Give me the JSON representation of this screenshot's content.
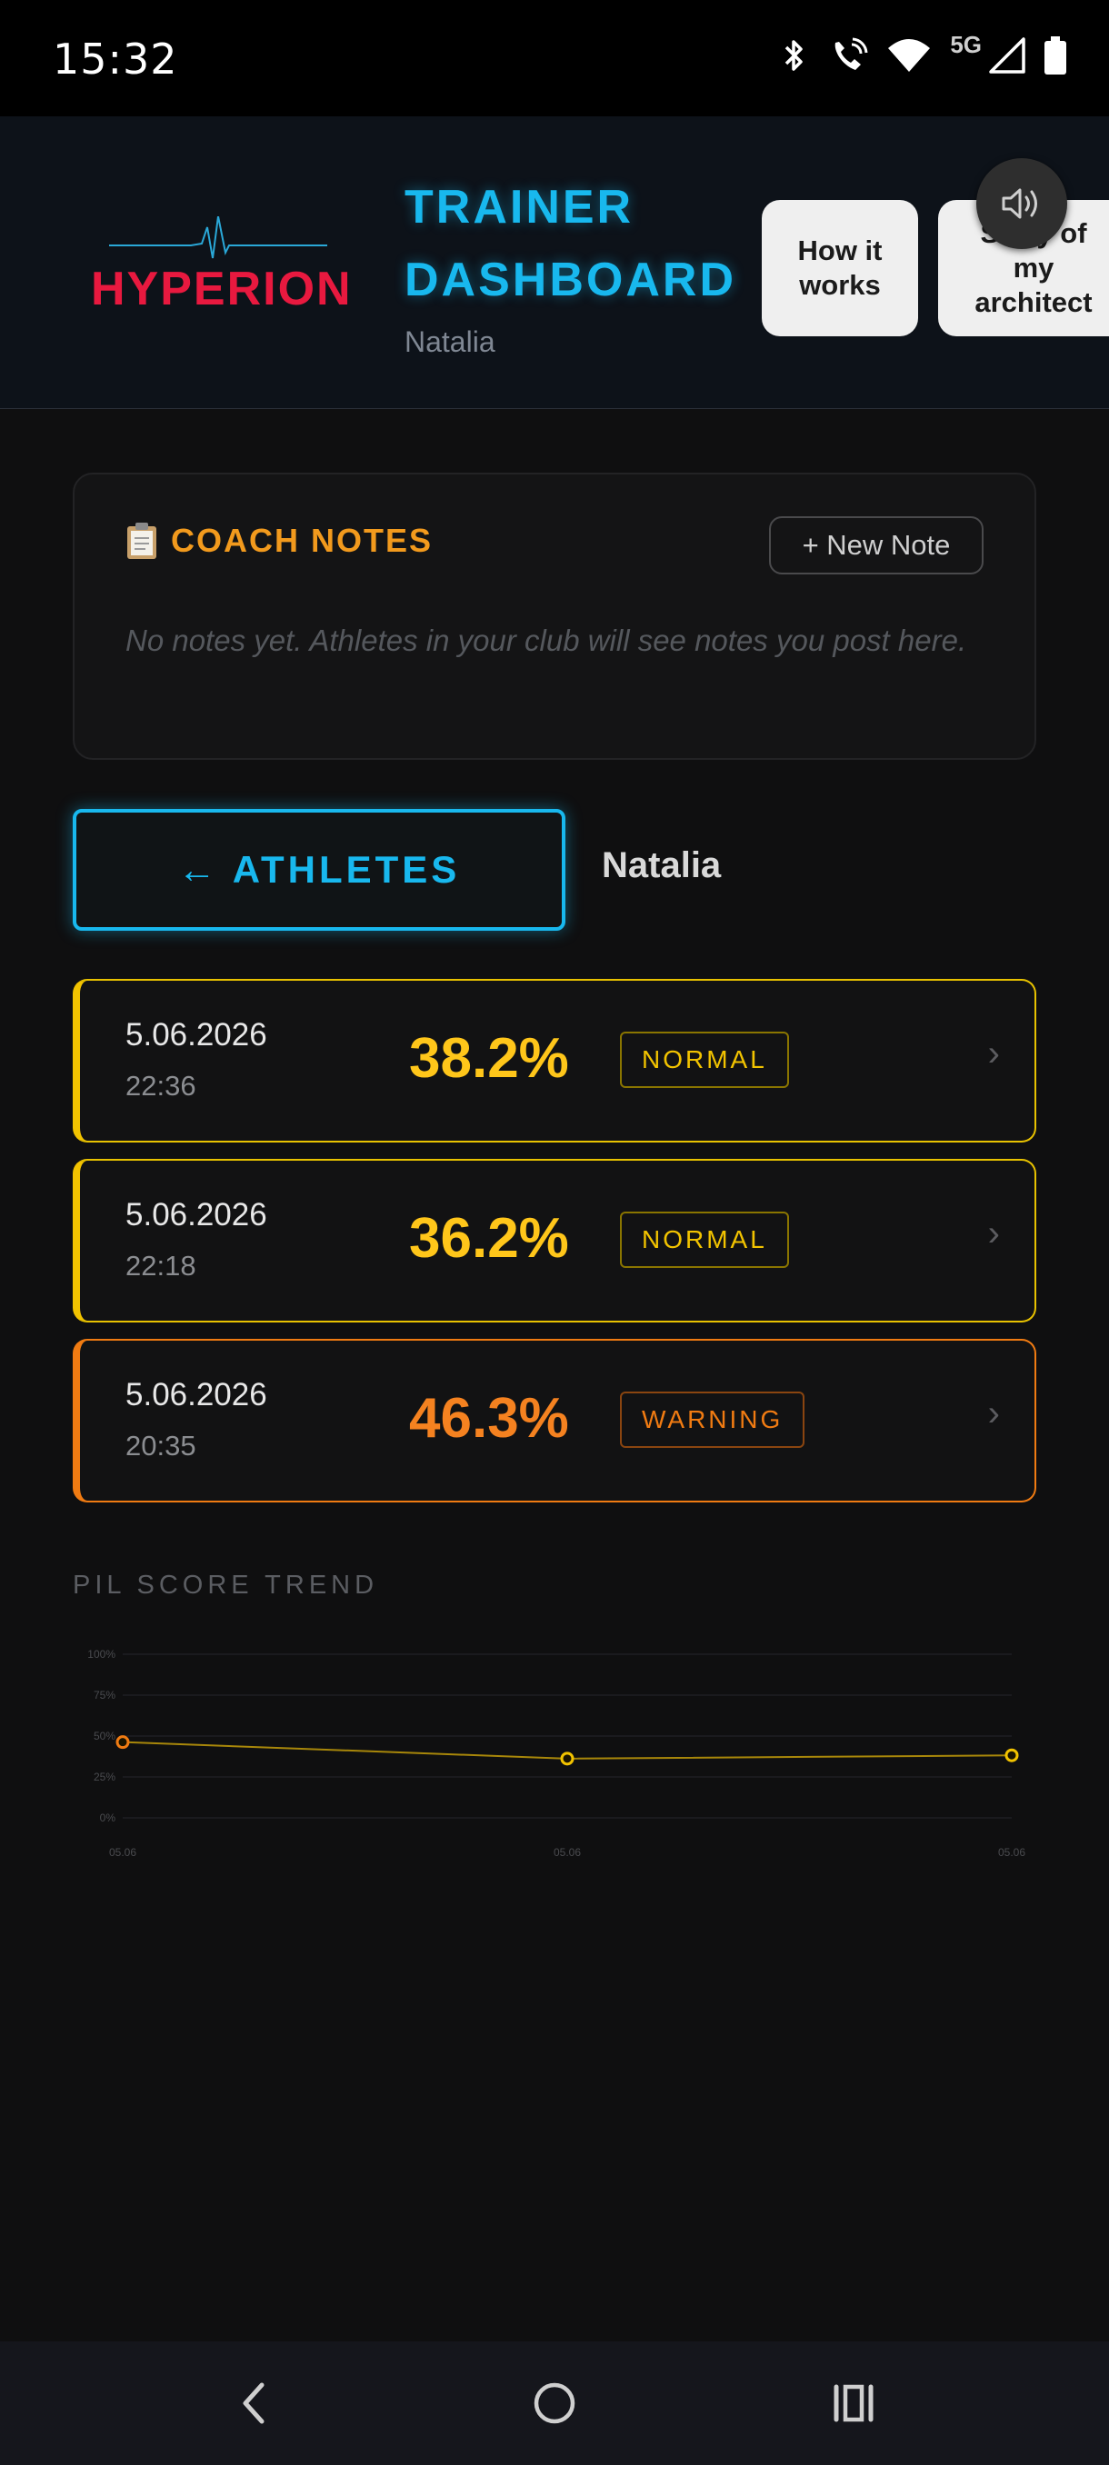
{
  "status_bar": {
    "time": "15:32",
    "network": "5G",
    "icons": [
      "bluetooth-icon",
      "wifi-call-icon",
      "wifi-icon",
      "signal-icon",
      "battery-icon"
    ]
  },
  "header": {
    "logo_text": "HYPERION",
    "title_line1": "TRAINER",
    "title_line2": "DASHBOARD",
    "subtitle": "Natalia",
    "how_it_works_label": "How it works",
    "story_label": "Story of my architect",
    "sound_icon": "speaker-icon"
  },
  "notes": {
    "title": "COACH NOTES",
    "icon": "clipboard-icon",
    "new_note_label": "+ New Note",
    "empty_text": "No notes yet. Athletes in your club will see notes you post here."
  },
  "athletes": {
    "back_label": "← ATHLETES",
    "name": "Natalia"
  },
  "sessions": [
    {
      "date": "5.06.2026",
      "time": "22:36",
      "score": "38.2%",
      "status": "NORMAL"
    },
    {
      "date": "5.06.2026",
      "time": "22:18",
      "score": "36.2%",
      "status": "NORMAL"
    },
    {
      "date": "5.06.2026",
      "time": "20:35",
      "score": "46.3%",
      "status": "WARNING"
    }
  ],
  "colors": {
    "accent_cyan": "#18b8ee",
    "brand_red": "#e8193f",
    "normal_yellow": "#f2c300",
    "warning_orange": "#f07b12",
    "notes_orange": "#f29a1d"
  },
  "trend": {
    "title": "PIL SCORE TREND"
  },
  "chart_data": {
    "type": "line",
    "title": "PIL SCORE TREND",
    "x": [
      "05.06",
      "05.06",
      "05.06"
    ],
    "values": [
      46.3,
      36.2,
      38.2
    ],
    "y_ticks": [
      "100%",
      "75%",
      "50%",
      "25%",
      "0%"
    ],
    "ylim": [
      0,
      100
    ],
    "grid": true
  },
  "navbar": {
    "icons": [
      "back-icon",
      "home-icon",
      "recents-icon"
    ]
  }
}
